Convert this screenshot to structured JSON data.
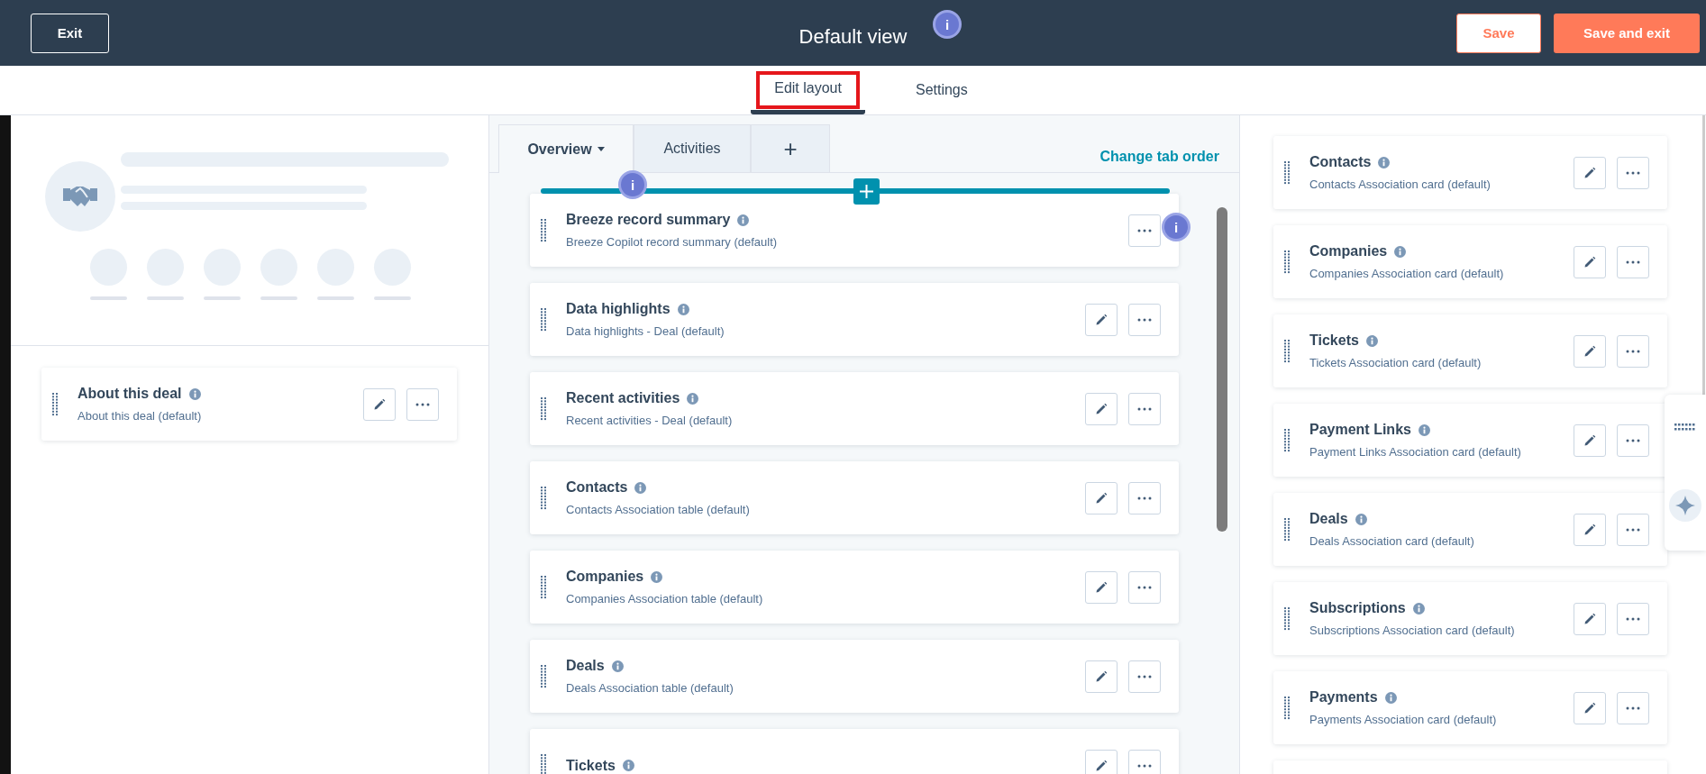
{
  "header": {
    "exit": "Exit",
    "title": "Default view",
    "info_badge": "i",
    "save": "Save",
    "save_exit": "Save and exit"
  },
  "view_tabs": [
    {
      "label": "Edit layout",
      "selected": true,
      "highlighted": true
    },
    {
      "label": "Settings",
      "selected": false,
      "highlighted": false
    }
  ],
  "left_panel": {
    "cards": [
      {
        "title": "About this deal",
        "subtitle": "About this deal (default)",
        "editable": true
      }
    ]
  },
  "middle": {
    "tabs": [
      {
        "label": "Overview",
        "selected": true,
        "kind": "dropdown"
      },
      {
        "label": "Activities",
        "selected": false,
        "kind": "tab"
      },
      {
        "label": "+",
        "selected": false,
        "kind": "add"
      }
    ],
    "change_tab_order": "Change tab order",
    "markers": [
      "i",
      "i"
    ],
    "cards": [
      {
        "title": "Breeze record summary",
        "subtitle": "Breeze Copilot record summary (default)",
        "editable": false
      },
      {
        "title": "Data highlights",
        "subtitle": "Data highlights - Deal (default)",
        "editable": true
      },
      {
        "title": "Recent activities",
        "subtitle": "Recent activities - Deal (default)",
        "editable": true
      },
      {
        "title": "Contacts",
        "subtitle": "Contacts Association table (default)",
        "editable": true
      },
      {
        "title": "Companies",
        "subtitle": "Companies Association table (default)",
        "editable": true
      },
      {
        "title": "Deals",
        "subtitle": "Deals Association table (default)",
        "editable": true
      },
      {
        "title": "Tickets",
        "editable": true
      }
    ]
  },
  "right_panel": {
    "cards": [
      {
        "title": "Contacts",
        "subtitle": "Contacts Association card (default)",
        "editable": true
      },
      {
        "title": "Companies",
        "subtitle": "Companies Association card (default)",
        "editable": true
      },
      {
        "title": "Tickets",
        "subtitle": "Tickets Association card (default)",
        "editable": true
      },
      {
        "title": "Payment Links",
        "subtitle": "Payment Links Association card (default)",
        "editable": true
      },
      {
        "title": "Deals",
        "subtitle": "Deals Association card (default)",
        "editable": true
      },
      {
        "title": "Subscriptions",
        "subtitle": "Subscriptions Association card (default)",
        "editable": true
      },
      {
        "title": "Payments",
        "subtitle": "Payments Association card (default)",
        "editable": true
      }
    ]
  }
}
